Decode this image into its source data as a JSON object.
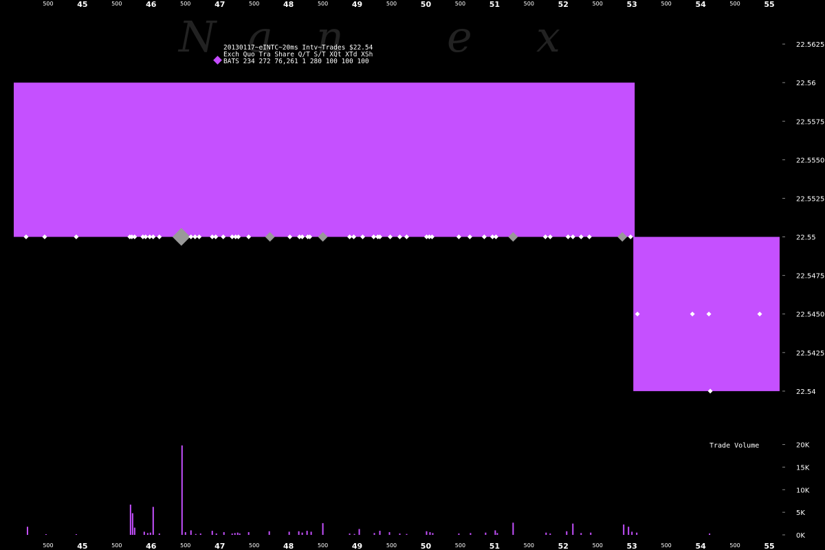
{
  "watermark": [
    "N",
    "a",
    "n",
    "e",
    "x"
  ],
  "legend": {
    "title": "20130117~eINTC~20ms Intv~Trades $22.54",
    "header": "Exch Quo Tra  Share  Q/T   S/T  XQt XTd XSh",
    "row": "BATS 234 272 76,261     1   280 100 100 100",
    "marker_color": "#c44bff"
  },
  "colors": {
    "background": "#000000",
    "quote_band": "#c550ff",
    "trade_marker": "#ffffff",
    "trade_marker_large": "#999999",
    "volume_bar": "#c550ff",
    "axis_text": "#ffffff"
  },
  "chart_data": [
    {
      "type": "area",
      "panel": "price",
      "x_axis": {
        "range": [
          44.0,
          55.15
        ],
        "major_ticks": [
          45,
          46,
          47,
          48,
          49,
          50,
          51,
          52,
          53,
          54,
          55
        ],
        "major_labels": [
          "45",
          "46",
          "47",
          "48",
          "49",
          "50",
          "51",
          "52",
          "53",
          "54",
          "55"
        ],
        "minor_ticks": [
          44.5,
          45.5,
          46.5,
          47.5,
          48.5,
          49.5,
          50.5,
          51.5,
          52.5,
          53.5,
          54.5
        ],
        "minor_label": "500"
      },
      "y_axis": {
        "range": [
          22.5375,
          22.565
        ],
        "ticks": [
          22.54,
          22.5425,
          22.545,
          22.5475,
          22.55,
          22.5525,
          22.555,
          22.5575,
          22.56,
          22.5625
        ],
        "tick_labels": [
          "22.54",
          "22.5425",
          "22.5450",
          "22.5475",
          "22.55",
          "22.5525",
          "22.5550",
          "22.5575",
          "22.56",
          "22.5625"
        ],
        "position": "right"
      },
      "quote_bands": [
        {
          "x_start": 44.0,
          "x_end": 53.04,
          "bid": 22.55,
          "ask": 22.56
        },
        {
          "x_start": 53.02,
          "x_end": 55.15,
          "bid": 22.54,
          "ask": 22.55
        }
      ],
      "trades": [
        {
          "x": 44.18,
          "price": 22.55,
          "size": "small"
        },
        {
          "x": 44.45,
          "price": 22.55,
          "size": "small"
        },
        {
          "x": 44.91,
          "price": 22.55,
          "size": "small"
        },
        {
          "x": 45.69,
          "price": 22.55,
          "size": "small"
        },
        {
          "x": 45.72,
          "price": 22.55,
          "size": "small"
        },
        {
          "x": 45.76,
          "price": 22.55,
          "size": "small"
        },
        {
          "x": 45.88,
          "price": 22.55,
          "size": "small"
        },
        {
          "x": 45.92,
          "price": 22.55,
          "size": "small"
        },
        {
          "x": 45.98,
          "price": 22.55,
          "size": "small"
        },
        {
          "x": 46.03,
          "price": 22.55,
          "size": "small"
        },
        {
          "x": 46.12,
          "price": 22.55,
          "size": "small"
        },
        {
          "x": 46.44,
          "price": 22.55,
          "size": "large"
        },
        {
          "x": 46.58,
          "price": 22.55,
          "size": "small"
        },
        {
          "x": 46.64,
          "price": 22.55,
          "size": "small"
        },
        {
          "x": 46.7,
          "price": 22.55,
          "size": "small"
        },
        {
          "x": 46.89,
          "price": 22.55,
          "size": "small"
        },
        {
          "x": 46.94,
          "price": 22.55,
          "size": "small"
        },
        {
          "x": 47.05,
          "price": 22.55,
          "size": "small"
        },
        {
          "x": 47.18,
          "price": 22.55,
          "size": "small"
        },
        {
          "x": 47.23,
          "price": 22.55,
          "size": "small"
        },
        {
          "x": 47.27,
          "price": 22.55,
          "size": "small"
        },
        {
          "x": 47.42,
          "price": 22.55,
          "size": "small"
        },
        {
          "x": 47.73,
          "price": 22.55,
          "size": "medium"
        },
        {
          "x": 48.02,
          "price": 22.55,
          "size": "small"
        },
        {
          "x": 48.16,
          "price": 22.55,
          "size": "small"
        },
        {
          "x": 48.2,
          "price": 22.55,
          "size": "small"
        },
        {
          "x": 48.28,
          "price": 22.55,
          "size": "small"
        },
        {
          "x": 48.31,
          "price": 22.55,
          "size": "small"
        },
        {
          "x": 48.5,
          "price": 22.55,
          "size": "medium"
        },
        {
          "x": 48.89,
          "price": 22.55,
          "size": "small"
        },
        {
          "x": 48.95,
          "price": 22.55,
          "size": "small"
        },
        {
          "x": 49.08,
          "price": 22.55,
          "size": "small"
        },
        {
          "x": 49.24,
          "price": 22.55,
          "size": "small"
        },
        {
          "x": 49.3,
          "price": 22.55,
          "size": "small"
        },
        {
          "x": 49.33,
          "price": 22.55,
          "size": "small"
        },
        {
          "x": 49.48,
          "price": 22.55,
          "size": "small"
        },
        {
          "x": 49.62,
          "price": 22.55,
          "size": "small"
        },
        {
          "x": 49.72,
          "price": 22.55,
          "size": "small"
        },
        {
          "x": 50.01,
          "price": 22.55,
          "size": "small"
        },
        {
          "x": 50.05,
          "price": 22.55,
          "size": "small"
        },
        {
          "x": 50.09,
          "price": 22.55,
          "size": "small"
        },
        {
          "x": 50.48,
          "price": 22.55,
          "size": "small"
        },
        {
          "x": 50.64,
          "price": 22.55,
          "size": "small"
        },
        {
          "x": 50.85,
          "price": 22.55,
          "size": "small"
        },
        {
          "x": 50.97,
          "price": 22.55,
          "size": "small"
        },
        {
          "x": 51.02,
          "price": 22.55,
          "size": "small"
        },
        {
          "x": 51.27,
          "price": 22.55,
          "size": "medium"
        },
        {
          "x": 51.74,
          "price": 22.55,
          "size": "small"
        },
        {
          "x": 51.81,
          "price": 22.55,
          "size": "small"
        },
        {
          "x": 52.07,
          "price": 22.55,
          "size": "small"
        },
        {
          "x": 52.14,
          "price": 22.55,
          "size": "small"
        },
        {
          "x": 52.26,
          "price": 22.55,
          "size": "small"
        },
        {
          "x": 52.38,
          "price": 22.55,
          "size": "small"
        },
        {
          "x": 52.86,
          "price": 22.55,
          "size": "medium"
        },
        {
          "x": 52.98,
          "price": 22.55,
          "size": "small"
        },
        {
          "x": 53.08,
          "price": 22.545,
          "size": "small"
        },
        {
          "x": 53.88,
          "price": 22.545,
          "size": "small"
        },
        {
          "x": 54.12,
          "price": 22.545,
          "size": "small"
        },
        {
          "x": 54.14,
          "price": 22.54,
          "size": "small"
        },
        {
          "x": 54.86,
          "price": 22.545,
          "size": "small"
        }
      ]
    },
    {
      "type": "bar",
      "panel": "volume",
      "title": "Trade Volume",
      "y_axis": {
        "range": [
          0,
          21000
        ],
        "ticks": [
          0,
          5000,
          10000,
          15000,
          20000
        ],
        "tick_labels": [
          "0K",
          "5K",
          "10K",
          "15K",
          "20K"
        ],
        "position": "right"
      },
      "bars": [
        {
          "x": 44.2,
          "value": 1800
        },
        {
          "x": 44.47,
          "value": 150
        },
        {
          "x": 44.91,
          "value": 150
        },
        {
          "x": 45.7,
          "value": 6700
        },
        {
          "x": 45.73,
          "value": 4800
        },
        {
          "x": 45.76,
          "value": 1600
        },
        {
          "x": 45.9,
          "value": 700
        },
        {
          "x": 45.95,
          "value": 400
        },
        {
          "x": 45.99,
          "value": 500
        },
        {
          "x": 46.03,
          "value": 6200
        },
        {
          "x": 46.12,
          "value": 300
        },
        {
          "x": 46.45,
          "value": 19800
        },
        {
          "x": 46.5,
          "value": 600
        },
        {
          "x": 46.58,
          "value": 1000
        },
        {
          "x": 46.65,
          "value": 200
        },
        {
          "x": 46.72,
          "value": 300
        },
        {
          "x": 46.89,
          "value": 900
        },
        {
          "x": 46.95,
          "value": 300
        },
        {
          "x": 47.06,
          "value": 600
        },
        {
          "x": 47.18,
          "value": 300
        },
        {
          "x": 47.22,
          "value": 400
        },
        {
          "x": 47.26,
          "value": 500
        },
        {
          "x": 47.29,
          "value": 300
        },
        {
          "x": 47.42,
          "value": 600
        },
        {
          "x": 47.72,
          "value": 800
        },
        {
          "x": 48.01,
          "value": 700
        },
        {
          "x": 48.15,
          "value": 800
        },
        {
          "x": 48.2,
          "value": 500
        },
        {
          "x": 48.27,
          "value": 900
        },
        {
          "x": 48.33,
          "value": 700
        },
        {
          "x": 48.5,
          "value": 2600
        },
        {
          "x": 48.89,
          "value": 300
        },
        {
          "x": 48.96,
          "value": 200
        },
        {
          "x": 49.03,
          "value": 1300
        },
        {
          "x": 49.25,
          "value": 400
        },
        {
          "x": 49.33,
          "value": 900
        },
        {
          "x": 49.47,
          "value": 600
        },
        {
          "x": 49.62,
          "value": 300
        },
        {
          "x": 49.72,
          "value": 200
        },
        {
          "x": 50.01,
          "value": 800
        },
        {
          "x": 50.06,
          "value": 600
        },
        {
          "x": 50.1,
          "value": 400
        },
        {
          "x": 50.48,
          "value": 300
        },
        {
          "x": 50.65,
          "value": 400
        },
        {
          "x": 50.87,
          "value": 500
        },
        {
          "x": 51.01,
          "value": 1000
        },
        {
          "x": 51.04,
          "value": 400
        },
        {
          "x": 51.27,
          "value": 2700
        },
        {
          "x": 51.75,
          "value": 500
        },
        {
          "x": 51.81,
          "value": 300
        },
        {
          "x": 52.05,
          "value": 800
        },
        {
          "x": 52.14,
          "value": 2500
        },
        {
          "x": 52.26,
          "value": 400
        },
        {
          "x": 52.4,
          "value": 500
        },
        {
          "x": 52.88,
          "value": 2300
        },
        {
          "x": 52.95,
          "value": 1800
        },
        {
          "x": 53.0,
          "value": 700
        },
        {
          "x": 53.07,
          "value": 500
        },
        {
          "x": 54.13,
          "value": 300
        }
      ]
    }
  ]
}
